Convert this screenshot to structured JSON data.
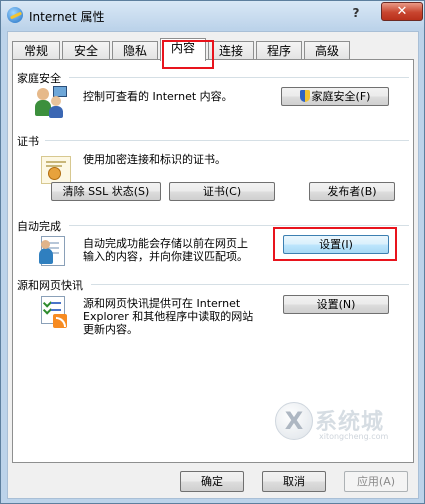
{
  "window": {
    "title": "Internet 属性",
    "help_label": "?",
    "close_label": "✕"
  },
  "tabs": [
    {
      "label": "常规",
      "active": false
    },
    {
      "label": "安全",
      "active": false
    },
    {
      "label": "隐私",
      "active": false
    },
    {
      "label": "内容",
      "active": true
    },
    {
      "label": "连接",
      "active": false
    },
    {
      "label": "程序",
      "active": false
    },
    {
      "label": "高级",
      "active": false
    }
  ],
  "family_safety": {
    "title": "家庭安全",
    "description": "控制可查看的 Internet 内容。",
    "button_label": "家庭安全(F)",
    "icon": "family-icon"
  },
  "certificates": {
    "title": "证书",
    "description": "使用加密连接和标识的证书。",
    "buttons": [
      "清除 SSL 状态(S)",
      "证书(C)",
      "发布者(B)"
    ],
    "icon": "certificate-icon"
  },
  "autocomplete": {
    "title": "自动完成",
    "description_line1": "自动完成功能会存储以前在网页上",
    "description_line2": "输入的内容，并向你建议匹配项。",
    "button_label": "设置(I)",
    "icon": "autocomplete-icon"
  },
  "feeds": {
    "title": "源和网页快讯",
    "description_line1": "源和网页快讯提供可在 Internet",
    "description_line2": "Explorer 和其他程序中读取的网站",
    "description_line3": "更新内容。",
    "button_label": "设置(N)",
    "icon": "rss-feed-icon"
  },
  "footer": {
    "ok_label": "确定",
    "cancel_label": "取消",
    "apply_label": "应用(A)",
    "apply_enabled": false
  },
  "watermark": {
    "logo_char": "X",
    "text": "系统城",
    "url": "xitongcheng.com"
  },
  "colors": {
    "highlight_red": "#e8141d",
    "close_button": "#c8452f"
  }
}
